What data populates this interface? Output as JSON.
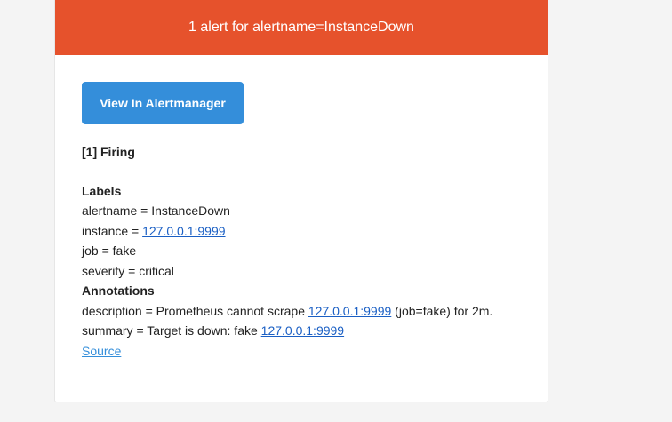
{
  "header": {
    "title": "1 alert for alertname=InstanceDown"
  },
  "button": {
    "label": "View In Alertmanager"
  },
  "firing": {
    "text": "[1] Firing"
  },
  "labels": {
    "title": "Labels",
    "alertname": "alertname = InstanceDown",
    "instance_prefix": "instance = ",
    "instance_link": "127.0.0.1:9999",
    "job": "job = fake",
    "severity": "severity = critical"
  },
  "annotations": {
    "title": "Annotations",
    "description_prefix": "description = Prometheus cannot scrape ",
    "description_link": "127.0.0.1:9999",
    "description_suffix": " (job=fake) for 2m.",
    "summary_prefix": "summary = Target is down: fake ",
    "summary_link": "127.0.0.1:9999"
  },
  "source": {
    "label": "Source"
  },
  "colors": {
    "header_bg": "#e6522c",
    "button_bg": "#348eda",
    "link": "#1a5fc4"
  }
}
